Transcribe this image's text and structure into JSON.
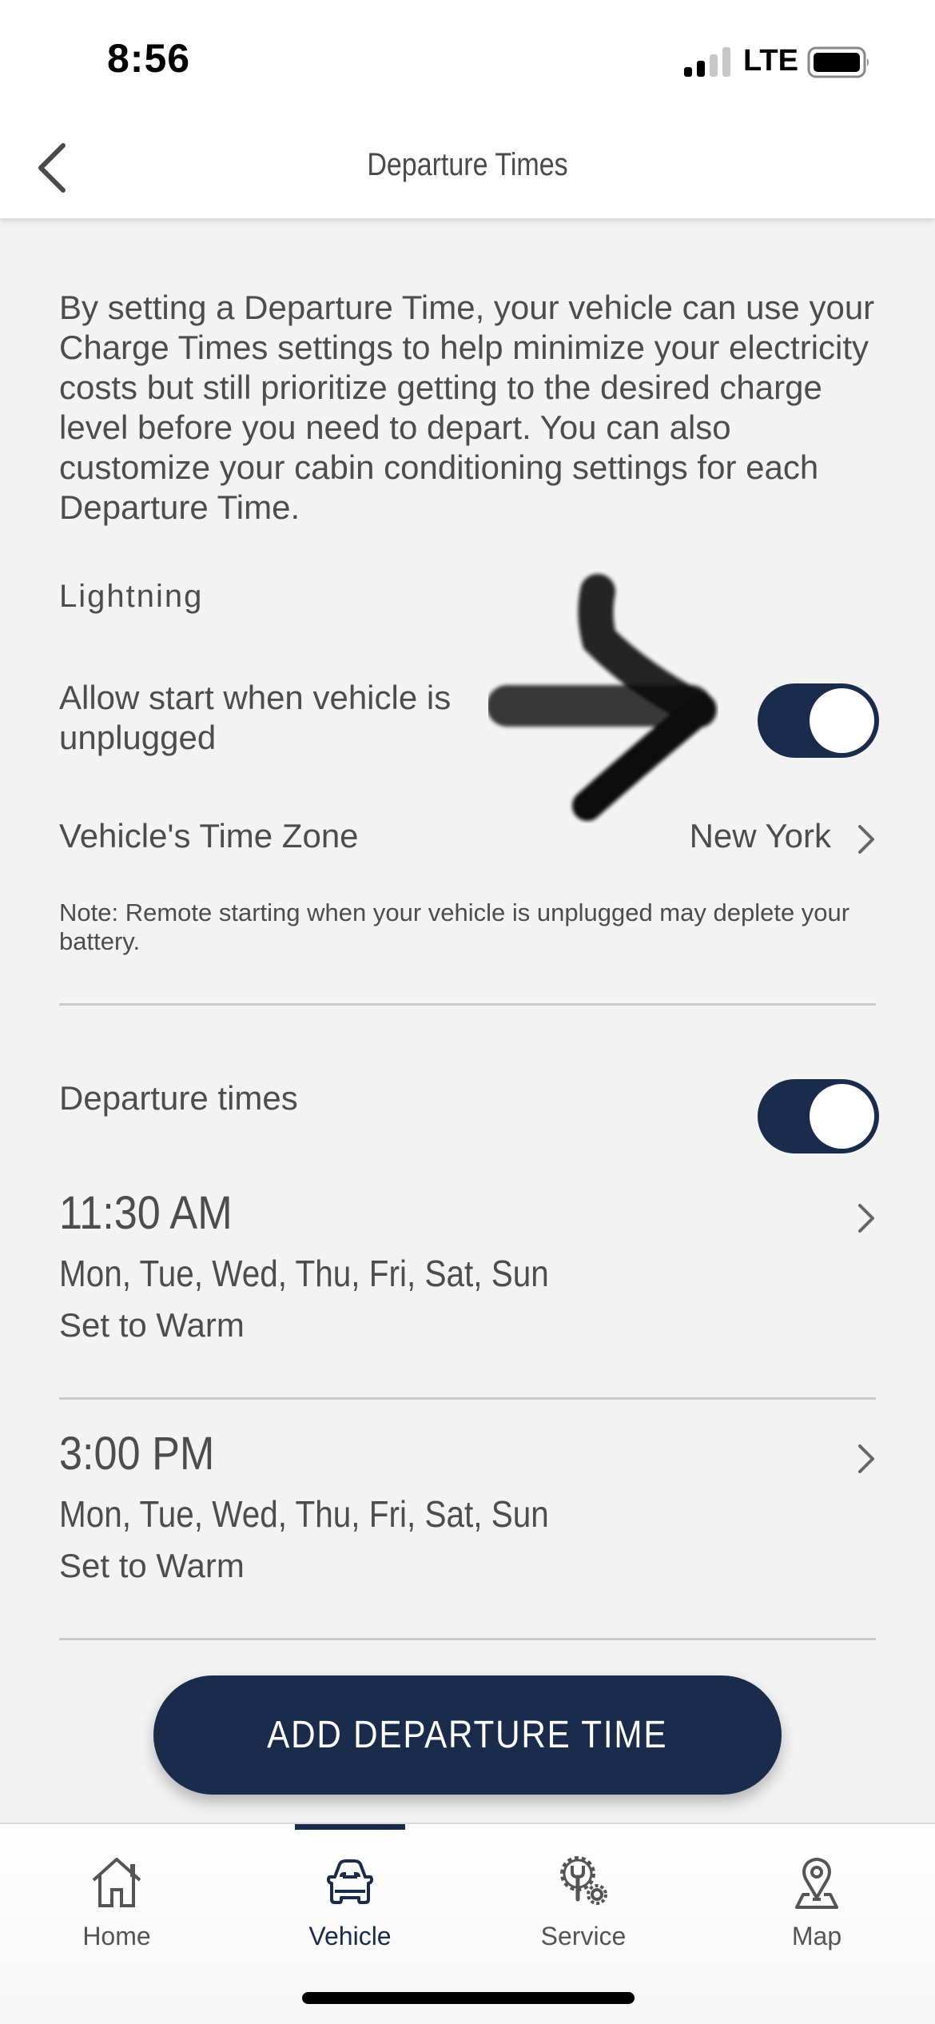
{
  "status_bar": {
    "time": "8:56",
    "network": "LTE",
    "signal_bars_active": 2,
    "signal_bars_total": 4,
    "battery_icon": "battery-full-icon"
  },
  "header": {
    "title": "Departure Times",
    "back_icon": "chevron-left-icon"
  },
  "intro_text": "By setting a Departure Time, your vehicle can use your Charge Times settings to help minimize your electricity costs but still prioritize getting to the desired charge level before you need to depart. You can also customize your cabin conditioning settings for each Departure Time.",
  "vehicle_section": {
    "label": "Lightning",
    "allow_start_label": "Allow start when vehicle is unplugged",
    "allow_start_enabled": true,
    "time_zone_label": "Vehicle's Time Zone",
    "time_zone_value": "New York",
    "note": "Note: Remote starting when your vehicle is unplugged may deplete your battery."
  },
  "departure_times": {
    "label": "Departure times",
    "enabled": true,
    "items": [
      {
        "time": "11:30 AM",
        "days": "Mon, Tue, Wed, Thu, Fri, Sat, Sun",
        "mode": "Set to Warm"
      },
      {
        "time": "3:00 PM",
        "days": "Mon, Tue, Wed, Thu, Fri, Sat, Sun",
        "mode": "Set to Warm"
      }
    ]
  },
  "add_button_label": "ADD DEPARTURE TIME",
  "tab_bar": {
    "active": "Vehicle",
    "tabs": [
      {
        "label": "Home",
        "icon": "home-icon"
      },
      {
        "label": "Vehicle",
        "icon": "car-icon"
      },
      {
        "label": "Service",
        "icon": "wrench-gear-icon"
      },
      {
        "label": "Map",
        "icon": "map-pin-icon"
      }
    ]
  },
  "colors": {
    "accent": "#1a2b4c",
    "background": "#f3f3f3",
    "text": "#4d4d4d",
    "divider": "#cbcbcb"
  },
  "annotation": {
    "type": "hand-drawn-arrow",
    "points_to": "allow-start-toggle"
  }
}
